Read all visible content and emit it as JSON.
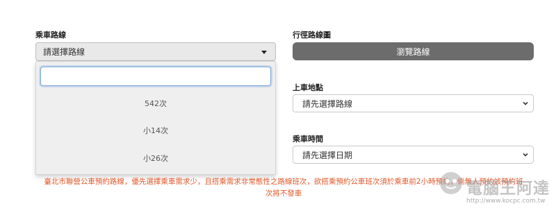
{
  "form": {
    "route_label": "乘車路線",
    "route_select_value": "請選擇路線",
    "route_search_value": "",
    "route_options": [
      "542次",
      "小14次",
      "小26次"
    ],
    "map_label": "行徑路線圖",
    "browse_button": "瀏覽路線",
    "boarding_label": "上車地點",
    "boarding_select_value": "請先選擇路線",
    "time_label": "乘車時間",
    "time_select_value": "請先選擇日期"
  },
  "notice": {
    "line1": "臺北市聯營公車預約路線，優先選擇乘車需求少，且搭乘需求非常態性之路線班次，欲搭乘預約公車班次須於乘車前2小時預約，倘無人預約該預約班",
    "line2": "次將不發車"
  },
  "watermark": {
    "brand": "電腦王阿達",
    "url": "http://www.kocpc.com.tw"
  },
  "colors": {
    "button_bg": "#6c6c6c",
    "notice_text": "#e2592a",
    "focus_border": "#7aa7d8"
  },
  "icons": {
    "route_select": "caret-down-icon",
    "boarding_select": "chevron-down-icon",
    "time_select": "chevron-down-icon",
    "watermark": "kocpc-logo-icon"
  }
}
